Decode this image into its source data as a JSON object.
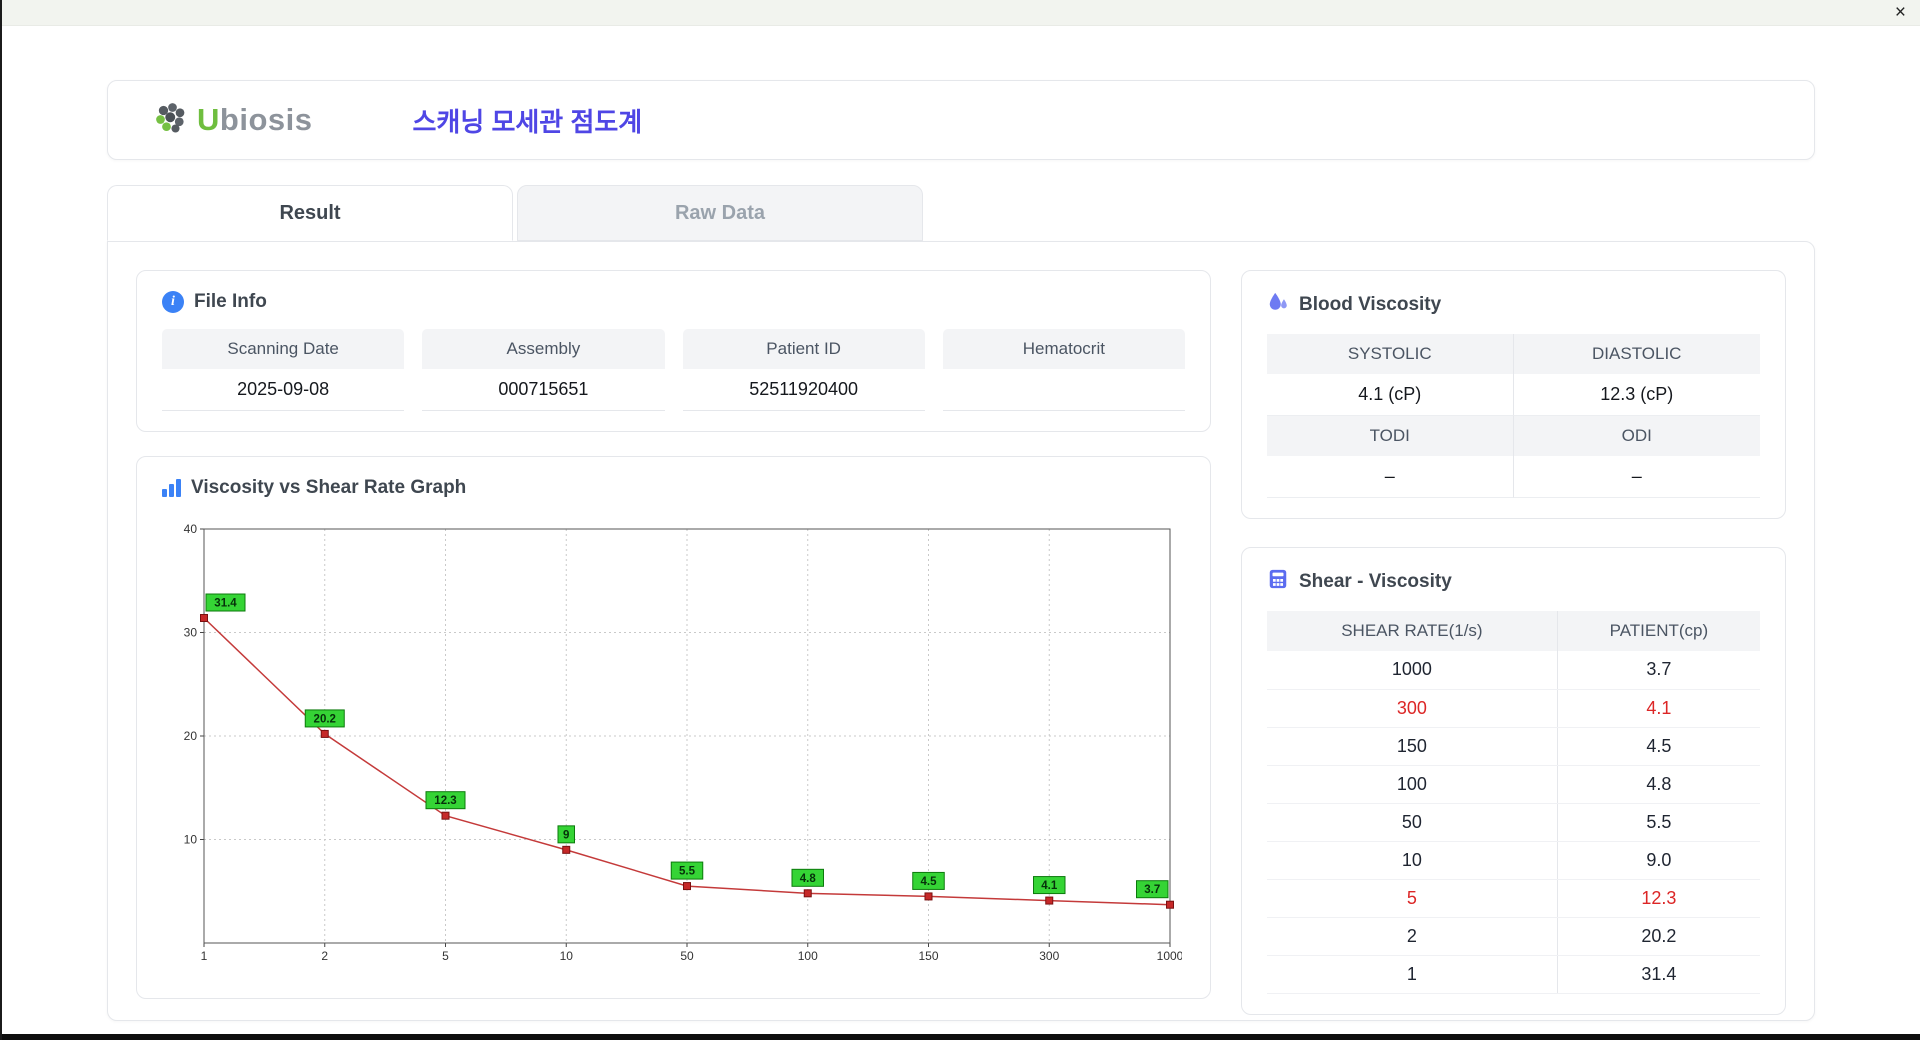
{
  "window": {
    "close_glyph": "×"
  },
  "header": {
    "brand_u": "U",
    "brand_rest": "biosis",
    "title": "스캐닝 모세관 점도계"
  },
  "tabs": [
    {
      "label": "Result",
      "active": true
    },
    {
      "label": "Raw Data",
      "active": false
    }
  ],
  "file_info": {
    "title": "File Info",
    "fields": [
      {
        "label": "Scanning Date",
        "value": "2025-09-08"
      },
      {
        "label": "Assembly",
        "value": "000715651"
      },
      {
        "label": "Patient ID",
        "value": "52511920400"
      },
      {
        "label": "Hematocrit",
        "value": ""
      }
    ]
  },
  "blood_viscosity": {
    "title": "Blood Viscosity",
    "rows": [
      [
        {
          "label": "SYSTOLIC",
          "value": "4.1 (cP)"
        },
        {
          "label": "DIASTOLIC",
          "value": "12.3 (cP)"
        }
      ],
      [
        {
          "label": "TODI",
          "value": "–"
        },
        {
          "label": "ODI",
          "value": "–"
        }
      ]
    ]
  },
  "graph": {
    "title": "Viscosity vs Shear Rate Graph"
  },
  "shear_viscosity": {
    "title": "Shear - Viscosity",
    "columns": [
      "SHEAR RATE(1/s)",
      "PATIENT(cp)"
    ],
    "rows": [
      {
        "rate": "1000",
        "value": "3.7",
        "highlight": false
      },
      {
        "rate": "300",
        "value": "4.1",
        "highlight": true
      },
      {
        "rate": "150",
        "value": "4.5",
        "highlight": false
      },
      {
        "rate": "100",
        "value": "4.8",
        "highlight": false
      },
      {
        "rate": "50",
        "value": "5.5",
        "highlight": false
      },
      {
        "rate": "10",
        "value": "9.0",
        "highlight": false
      },
      {
        "rate": "5",
        "value": "12.3",
        "highlight": true
      },
      {
        "rate": "2",
        "value": "20.2",
        "highlight": false
      },
      {
        "rate": "1",
        "value": "31.4",
        "highlight": false
      }
    ]
  },
  "chart_data": {
    "type": "line",
    "title": "Viscosity vs Shear Rate Graph",
    "x_scale": "category",
    "categories": [
      "1",
      "2",
      "5",
      "10",
      "50",
      "100",
      "150",
      "300",
      "1000"
    ],
    "values": [
      31.4,
      20.2,
      12.3,
      9,
      5.5,
      4.8,
      4.5,
      4.1,
      3.7
    ],
    "labels": [
      "31.4",
      "20.2",
      "12.3",
      "9",
      "5.5",
      "4.8",
      "4.5",
      "4.1",
      "3.7"
    ],
    "ylim": [
      0,
      40
    ],
    "yticks": [
      10,
      20,
      30,
      40
    ],
    "grid": true,
    "legend": "none",
    "line_color": "#c43a3a",
    "marker_color": "#c62828",
    "label_bg": "#35d435",
    "label_border": "#0c7a0c"
  }
}
